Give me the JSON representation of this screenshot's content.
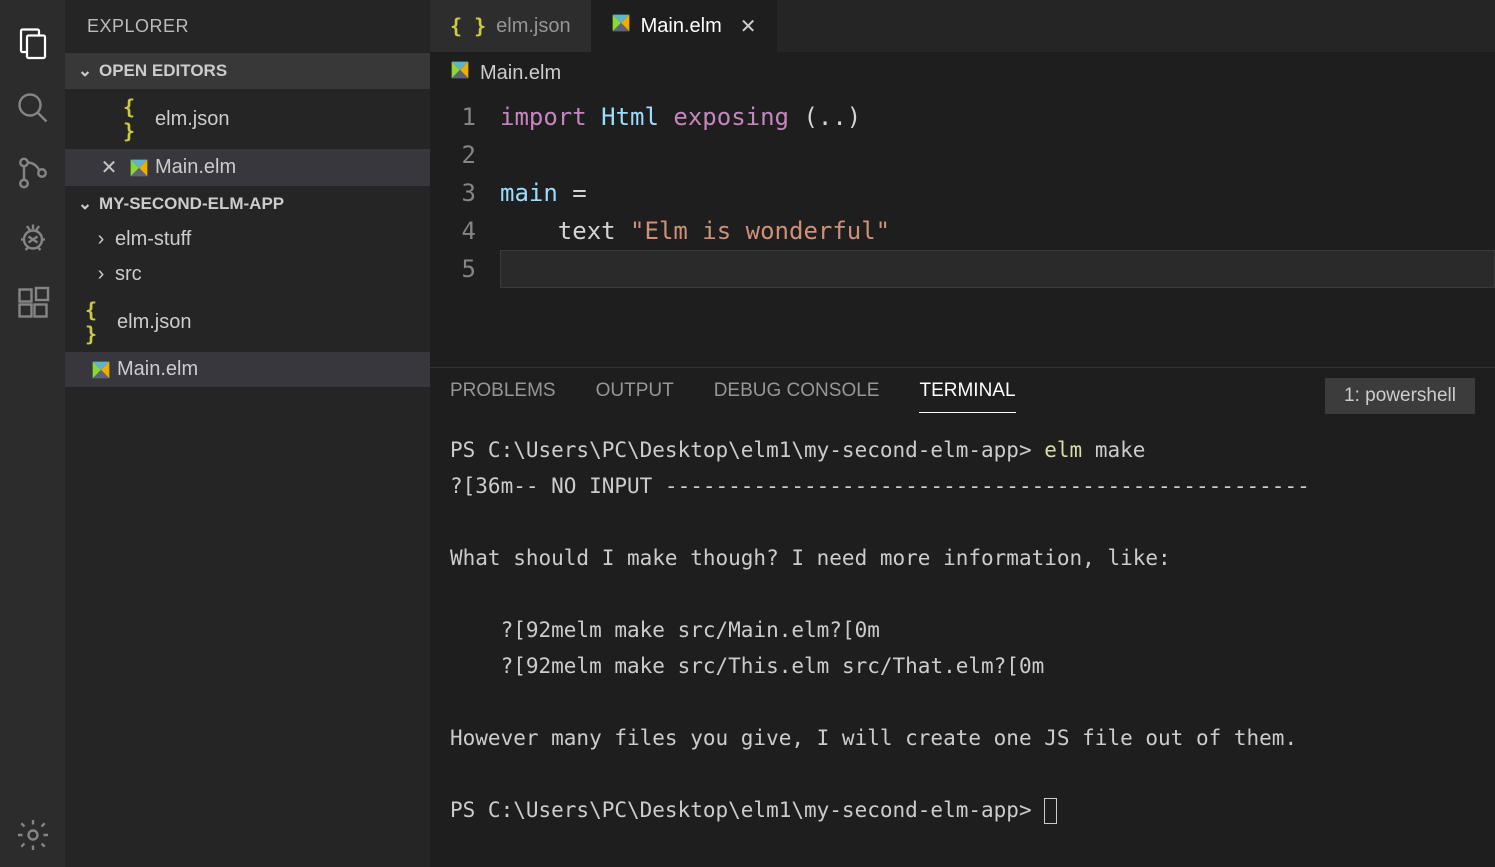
{
  "sidebar": {
    "title": "EXPLORER",
    "openEditors": {
      "label": "OPEN EDITORS",
      "items": [
        {
          "name": "elm.json",
          "icon": "json"
        },
        {
          "name": "Main.elm",
          "icon": "elm",
          "closeable": true,
          "active": true
        }
      ]
    },
    "workspace": {
      "label": "MY-SECOND-ELM-APP",
      "folders": [
        {
          "name": "elm-stuff"
        },
        {
          "name": "src"
        }
      ],
      "files": [
        {
          "name": "elm.json",
          "icon": "json"
        },
        {
          "name": "Main.elm",
          "icon": "elm",
          "active": true
        }
      ]
    }
  },
  "tabs": [
    {
      "name": "elm.json",
      "icon": "json",
      "active": false
    },
    {
      "name": "Main.elm",
      "icon": "elm",
      "active": true,
      "closeable": true
    }
  ],
  "breadcrumb": {
    "file": "Main.elm",
    "icon": "elm"
  },
  "editor": {
    "lines": [
      "1",
      "2",
      "3",
      "4",
      "5"
    ],
    "tokens": {
      "l1_import": "import",
      "l1_html": "Html",
      "l1_exposing": "exposing",
      "l1_paren": "(..)",
      "l3_main": "main",
      "l3_eq": "=",
      "l4_text": "text",
      "l4_str": "\"Elm is wonderful\""
    }
  },
  "panel": {
    "tabs": {
      "problems": "PROBLEMS",
      "output": "OUTPUT",
      "debug": "DEBUG CONSOLE",
      "terminal": "TERMINAL"
    },
    "selector": "1: powershell"
  },
  "terminal": {
    "prompt1_path": "PS C:\\Users\\PC\\Desktop\\elm1\\my-second-elm-app>",
    "cmd": "elm",
    "cmd_arg": "make",
    "noinput": "?[36m-- NO INPUT ---------------------------------------------------",
    "q": "What should I make though? I need more information, like:",
    "ex1": "    ?[92melm make src/Main.elm?[0m",
    "ex2": "    ?[92melm make src/This.elm src/That.elm?[0m",
    "however": "However many files you give, I will create one JS file out of them.",
    "prompt2_path": "PS C:\\Users\\PC\\Desktop\\elm1\\my-second-elm-app>"
  }
}
